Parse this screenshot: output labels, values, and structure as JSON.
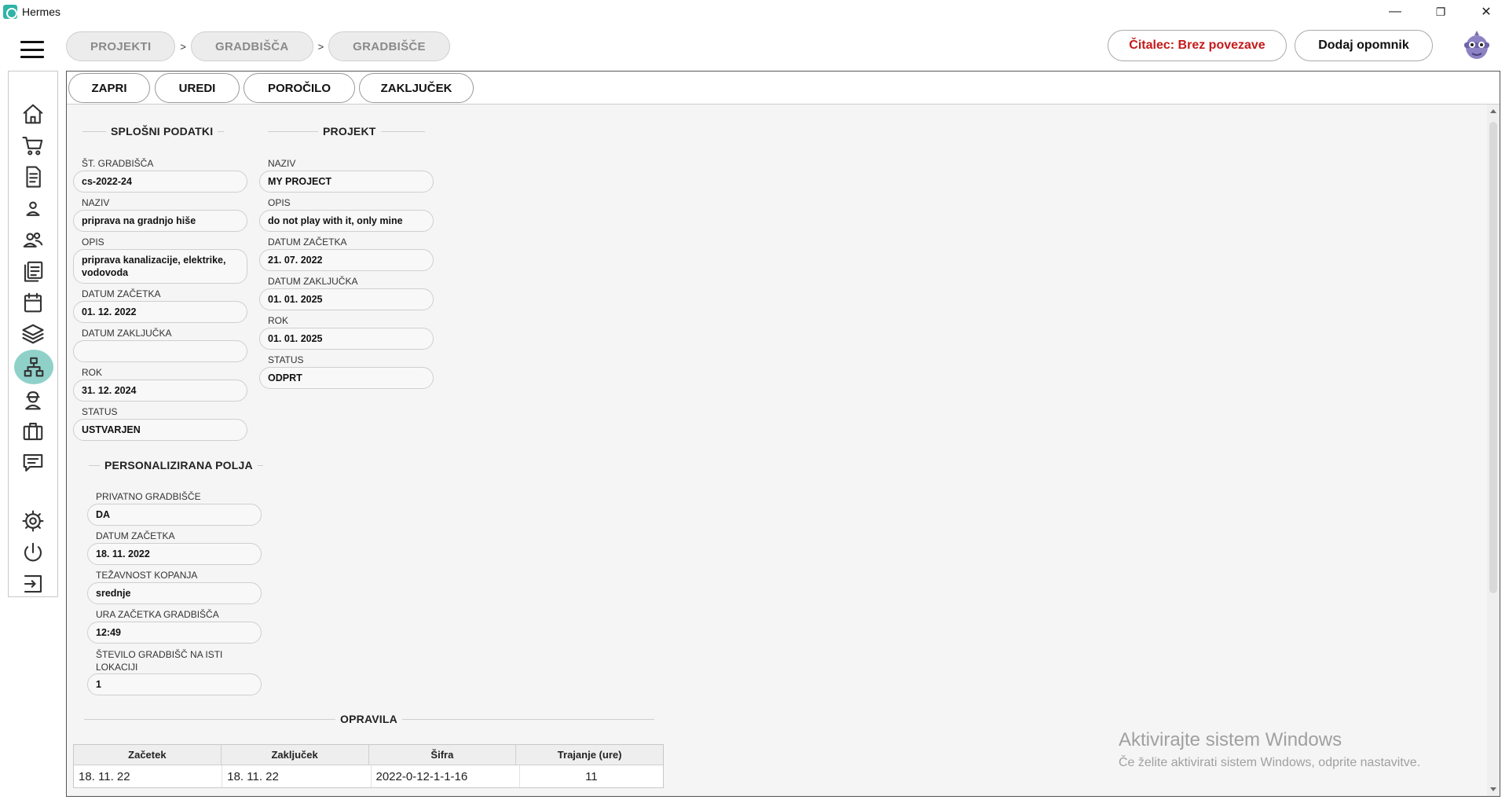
{
  "window": {
    "title": "Hermes",
    "minimize": "—",
    "restore": "❐",
    "close": "✕"
  },
  "breadcrumb": [
    {
      "label": "PROJEKTI"
    },
    {
      "label": "GRADBIŠČA"
    },
    {
      "label": "GRADBIŠČE"
    }
  ],
  "breadcrumb_sep": ">",
  "header": {
    "reader_label": "Čitalec: Brez povezave",
    "reader_color": "#c41a1a",
    "reminder_label": "Dodaj opomnik"
  },
  "sidebar": {
    "items": [
      {
        "icon": "home-icon"
      },
      {
        "icon": "cart-icon"
      },
      {
        "icon": "document-icon"
      },
      {
        "icon": "user-icon"
      },
      {
        "icon": "users-icon"
      },
      {
        "icon": "list-icon"
      },
      {
        "icon": "calendar-icon"
      },
      {
        "icon": "layers-icon"
      },
      {
        "icon": "sitemap-icon",
        "active": true
      },
      {
        "icon": "worker-icon"
      },
      {
        "icon": "briefcase-icon"
      },
      {
        "icon": "chat-icon"
      },
      {
        "icon": "gear-icon"
      },
      {
        "icon": "power-icon"
      },
      {
        "icon": "logout-icon"
      }
    ],
    "active_color": "#8fd1c9"
  },
  "toolbar": {
    "close_label": "ZAPRI",
    "edit_label": "UREDI",
    "report_label": "POROČILO",
    "conclusion_label": "ZAKLJUČEK"
  },
  "general": {
    "title": "SPLOŠNI PODATKI",
    "site_no_label": "ŠT. GRADBIŠČA",
    "site_no": "cs-2022-24",
    "name_label": "NAZIV",
    "name": "priprava na gradnjo hiše",
    "desc_label": "OPIS",
    "desc": "priprava kanalizacije, elektrike, vodovoda",
    "start_label": "DATUM ZAČETKA",
    "start": "01. 12. 2022",
    "end_label": "DATUM ZAKLJUČKA",
    "end": "",
    "deadline_label": "ROK",
    "deadline": "31. 12. 2024",
    "status_label": "STATUS",
    "status": "USTVARJEN"
  },
  "project": {
    "title": "PROJEKT",
    "name_label": "NAZIV",
    "name": "MY PROJECT",
    "desc_label": "OPIS",
    "desc": "do not play with it, only mine",
    "start_label": "DATUM ZAČETKA",
    "start": "21. 07. 2022",
    "end_label": "DATUM ZAKLJUČKA",
    "end": "01. 01. 2025",
    "deadline_label": "ROK",
    "deadline": "01. 01. 2025",
    "status_label": "STATUS",
    "status": "ODPRT"
  },
  "custom": {
    "title": "PERSONALIZIRANA POLJA",
    "private_label": "PRIVATNO GRADBIŠČE",
    "private": "DA",
    "start_label": "DATUM ZAČETKA",
    "start": "18. 11. 2022",
    "digging_label": "TEŽAVNOST KOPANJA",
    "digging": "srednje",
    "hour_label": "URA ZAČETKA GRADBIŠČA",
    "hour": "12:49",
    "count_label": "ŠTEVILO GRADBIŠČ NA ISTI LOKACIJI",
    "count": "1"
  },
  "tasks": {
    "title": "OPRAVILA",
    "columns": [
      "Začetek",
      "Zaključek",
      "Šifra",
      "Trajanje (ure)"
    ],
    "rows": [
      [
        "18. 11. 22",
        "18. 11. 22",
        "2022-0-12-1-1-16",
        "11"
      ]
    ]
  },
  "watermark": {
    "title": "Aktivirajte sistem Windows",
    "subtitle": "Če želite aktivirati sistem Windows, odprite nastavitve."
  }
}
